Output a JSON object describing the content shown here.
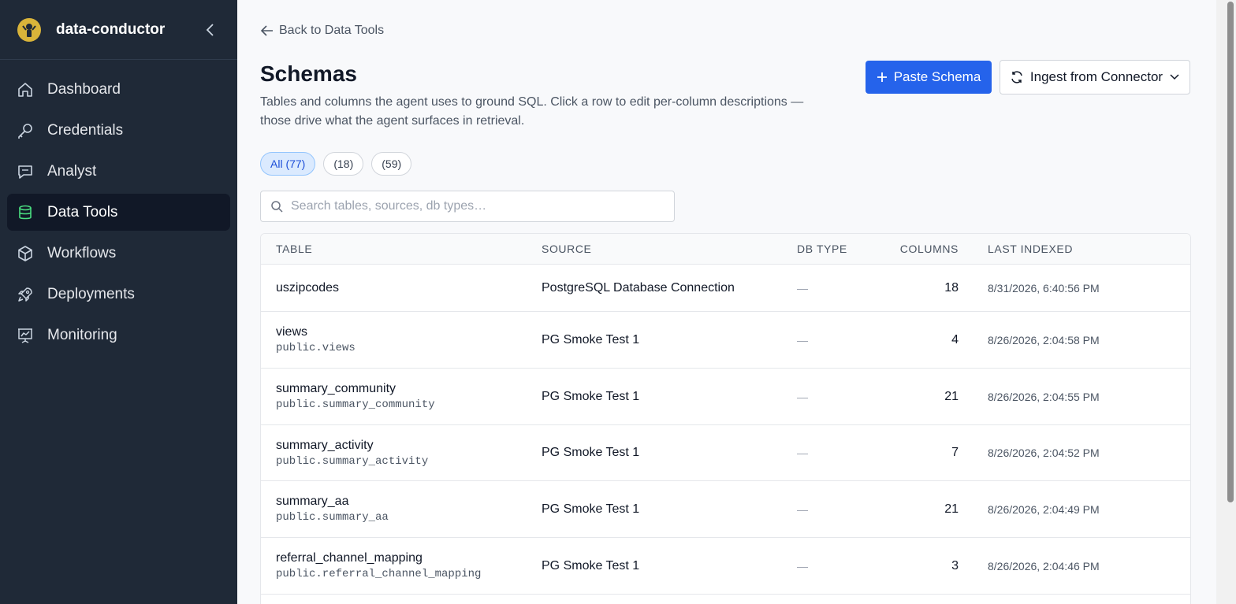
{
  "app": {
    "name": "data-conductor",
    "accent": "#2563eb"
  },
  "sidebar": {
    "items": [
      {
        "label": "Dashboard",
        "icon": "home-icon"
      },
      {
        "label": "Credentials",
        "icon": "key-icon"
      },
      {
        "label": "Analyst",
        "icon": "chat-icon"
      },
      {
        "label": "Data Tools",
        "icon": "database-icon",
        "active": true
      },
      {
        "label": "Workflows",
        "icon": "cube-icon"
      },
      {
        "label": "Deployments",
        "icon": "rocket-icon"
      },
      {
        "label": "Monitoring",
        "icon": "chart-board-icon"
      }
    ]
  },
  "header": {
    "back_label": "Back to Data Tools",
    "title": "Schemas",
    "description": "Tables and columns the agent uses to ground SQL. Click a row to edit per-column descriptions — those drive what the agent surfaces in retrieval.",
    "paste_label": "Paste Schema",
    "ingest_label": "Ingest from Connector"
  },
  "filters": [
    {
      "label": "All (77)",
      "active": true
    },
    {
      "label": "(18)"
    },
    {
      "label": "(59)"
    }
  ],
  "search": {
    "placeholder": "Search tables, sources, db types…"
  },
  "table": {
    "columns": [
      "TABLE",
      "SOURCE",
      "DB TYPE",
      "COLUMNS",
      "LAST INDEXED"
    ],
    "rows": [
      {
        "name": "uszipcodes",
        "sub": "",
        "source": "PostgreSQL Database Connection",
        "db_type": "—",
        "columns": "18",
        "indexed": "8/31/2026, 6:40:56 PM"
      },
      {
        "name": "views",
        "sub": "public.views",
        "source": "PG Smoke Test 1",
        "db_type": "—",
        "columns": "4",
        "indexed": "8/26/2026, 2:04:58 PM"
      },
      {
        "name": "summary_community",
        "sub": "public.summary_community",
        "source": "PG Smoke Test 1",
        "db_type": "—",
        "columns": "21",
        "indexed": "8/26/2026, 2:04:55 PM"
      },
      {
        "name": "summary_activity",
        "sub": "public.summary_activity",
        "source": "PG Smoke Test 1",
        "db_type": "—",
        "columns": "7",
        "indexed": "8/26/2026, 2:04:52 PM"
      },
      {
        "name": "summary_aa",
        "sub": "public.summary_aa",
        "source": "PG Smoke Test 1",
        "db_type": "—",
        "columns": "21",
        "indexed": "8/26/2026, 2:04:49 PM"
      },
      {
        "name": "referral_channel_mapping",
        "sub": "public.referral_channel_mapping",
        "source": "PG Smoke Test 1",
        "db_type": "—",
        "columns": "3",
        "indexed": "8/26/2026, 2:04:46 PM"
      }
    ]
  }
}
